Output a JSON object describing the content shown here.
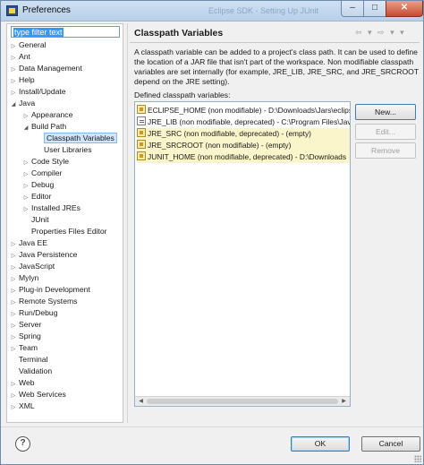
{
  "window": {
    "title": "Preferences",
    "ghost_title": "Eclipse SDK - Setting Up JUnit",
    "close_label": "✕",
    "min_label": "–",
    "max_label": "□"
  },
  "filter": {
    "text": "type filter text"
  },
  "tree": [
    {
      "label": "General",
      "depth": 0,
      "twisty": "▷",
      "selected": false
    },
    {
      "label": "Ant",
      "depth": 0,
      "twisty": "▷",
      "selected": false
    },
    {
      "label": "Data Management",
      "depth": 0,
      "twisty": "▷",
      "selected": false
    },
    {
      "label": "Help",
      "depth": 0,
      "twisty": "▷",
      "selected": false
    },
    {
      "label": "Install/Update",
      "depth": 0,
      "twisty": "▷",
      "selected": false
    },
    {
      "label": "Java",
      "depth": 0,
      "twisty": "◢",
      "selected": false
    },
    {
      "label": "Appearance",
      "depth": 1,
      "twisty": "▷",
      "selected": false
    },
    {
      "label": "Build Path",
      "depth": 1,
      "twisty": "◢",
      "selected": false
    },
    {
      "label": "Classpath Variables",
      "depth": 2,
      "twisty": "",
      "selected": true
    },
    {
      "label": "User Libraries",
      "depth": 2,
      "twisty": "",
      "selected": false
    },
    {
      "label": "Code Style",
      "depth": 1,
      "twisty": "▷",
      "selected": false
    },
    {
      "label": "Compiler",
      "depth": 1,
      "twisty": "▷",
      "selected": false
    },
    {
      "label": "Debug",
      "depth": 1,
      "twisty": "▷",
      "selected": false
    },
    {
      "label": "Editor",
      "depth": 1,
      "twisty": "▷",
      "selected": false
    },
    {
      "label": "Installed JREs",
      "depth": 1,
      "twisty": "▷",
      "selected": false
    },
    {
      "label": "JUnit",
      "depth": 1,
      "twisty": "",
      "selected": false
    },
    {
      "label": "Properties Files Editor",
      "depth": 1,
      "twisty": "",
      "selected": false
    },
    {
      "label": "Java EE",
      "depth": 0,
      "twisty": "▷",
      "selected": false
    },
    {
      "label": "Java Persistence",
      "depth": 0,
      "twisty": "▷",
      "selected": false
    },
    {
      "label": "JavaScript",
      "depth": 0,
      "twisty": "▷",
      "selected": false
    },
    {
      "label": "Mylyn",
      "depth": 0,
      "twisty": "▷",
      "selected": false
    },
    {
      "label": "Plug-in Development",
      "depth": 0,
      "twisty": "▷",
      "selected": false
    },
    {
      "label": "Remote Systems",
      "depth": 0,
      "twisty": "▷",
      "selected": false
    },
    {
      "label": "Run/Debug",
      "depth": 0,
      "twisty": "▷",
      "selected": false
    },
    {
      "label": "Server",
      "depth": 0,
      "twisty": "▷",
      "selected": false
    },
    {
      "label": "Spring",
      "depth": 0,
      "twisty": "▷",
      "selected": false
    },
    {
      "label": "Team",
      "depth": 0,
      "twisty": "▷",
      "selected": false
    },
    {
      "label": "Terminal",
      "depth": 0,
      "twisty": "",
      "selected": false
    },
    {
      "label": "Validation",
      "depth": 0,
      "twisty": "",
      "selected": false
    },
    {
      "label": "Web",
      "depth": 0,
      "twisty": "▷",
      "selected": false
    },
    {
      "label": "Web Services",
      "depth": 0,
      "twisty": "▷",
      "selected": false
    },
    {
      "label": "XML",
      "depth": 0,
      "twisty": "▷",
      "selected": false
    }
  ],
  "page": {
    "title": "Classpath Variables",
    "nav_arrows": "⇦ ▾ ⇨ ▾ ▾",
    "description": "A classpath variable can be added to a project's class path. It can be used to define the location of a JAR file that isn't part of the workspace. Non modifiable classpath variables are set internally (for example, JRE_LIB, JRE_SRC, and JRE_SRCROOT depend on the JRE setting).",
    "list_label": "Defined classpath variables:",
    "variables": [
      {
        "text": "ECLIPSE_HOME (non modifiable) - D:\\Downloads\\Jars\\eclipse",
        "icon": "jar-icon",
        "highlight": false
      },
      {
        "text": "JRE_LIB (non modifiable, deprecated) - C:\\Program Files\\Java",
        "icon": "doc-icon",
        "highlight": false
      },
      {
        "text": "JRE_SRC (non modifiable, deprecated) - (empty)",
        "icon": "jar-icon",
        "highlight": true
      },
      {
        "text": "JRE_SRCROOT (non modifiable) - (empty)",
        "icon": "jar-icon",
        "highlight": true
      },
      {
        "text": "JUNIT_HOME (non modifiable, deprecated) - D:\\Downloads",
        "icon": "jar-icon",
        "highlight": true
      }
    ],
    "buttons": {
      "new": "New...",
      "edit": "Edit...",
      "remove": "Remove"
    }
  },
  "footer": {
    "help": "?",
    "ok": "OK",
    "cancel": "Cancel"
  }
}
